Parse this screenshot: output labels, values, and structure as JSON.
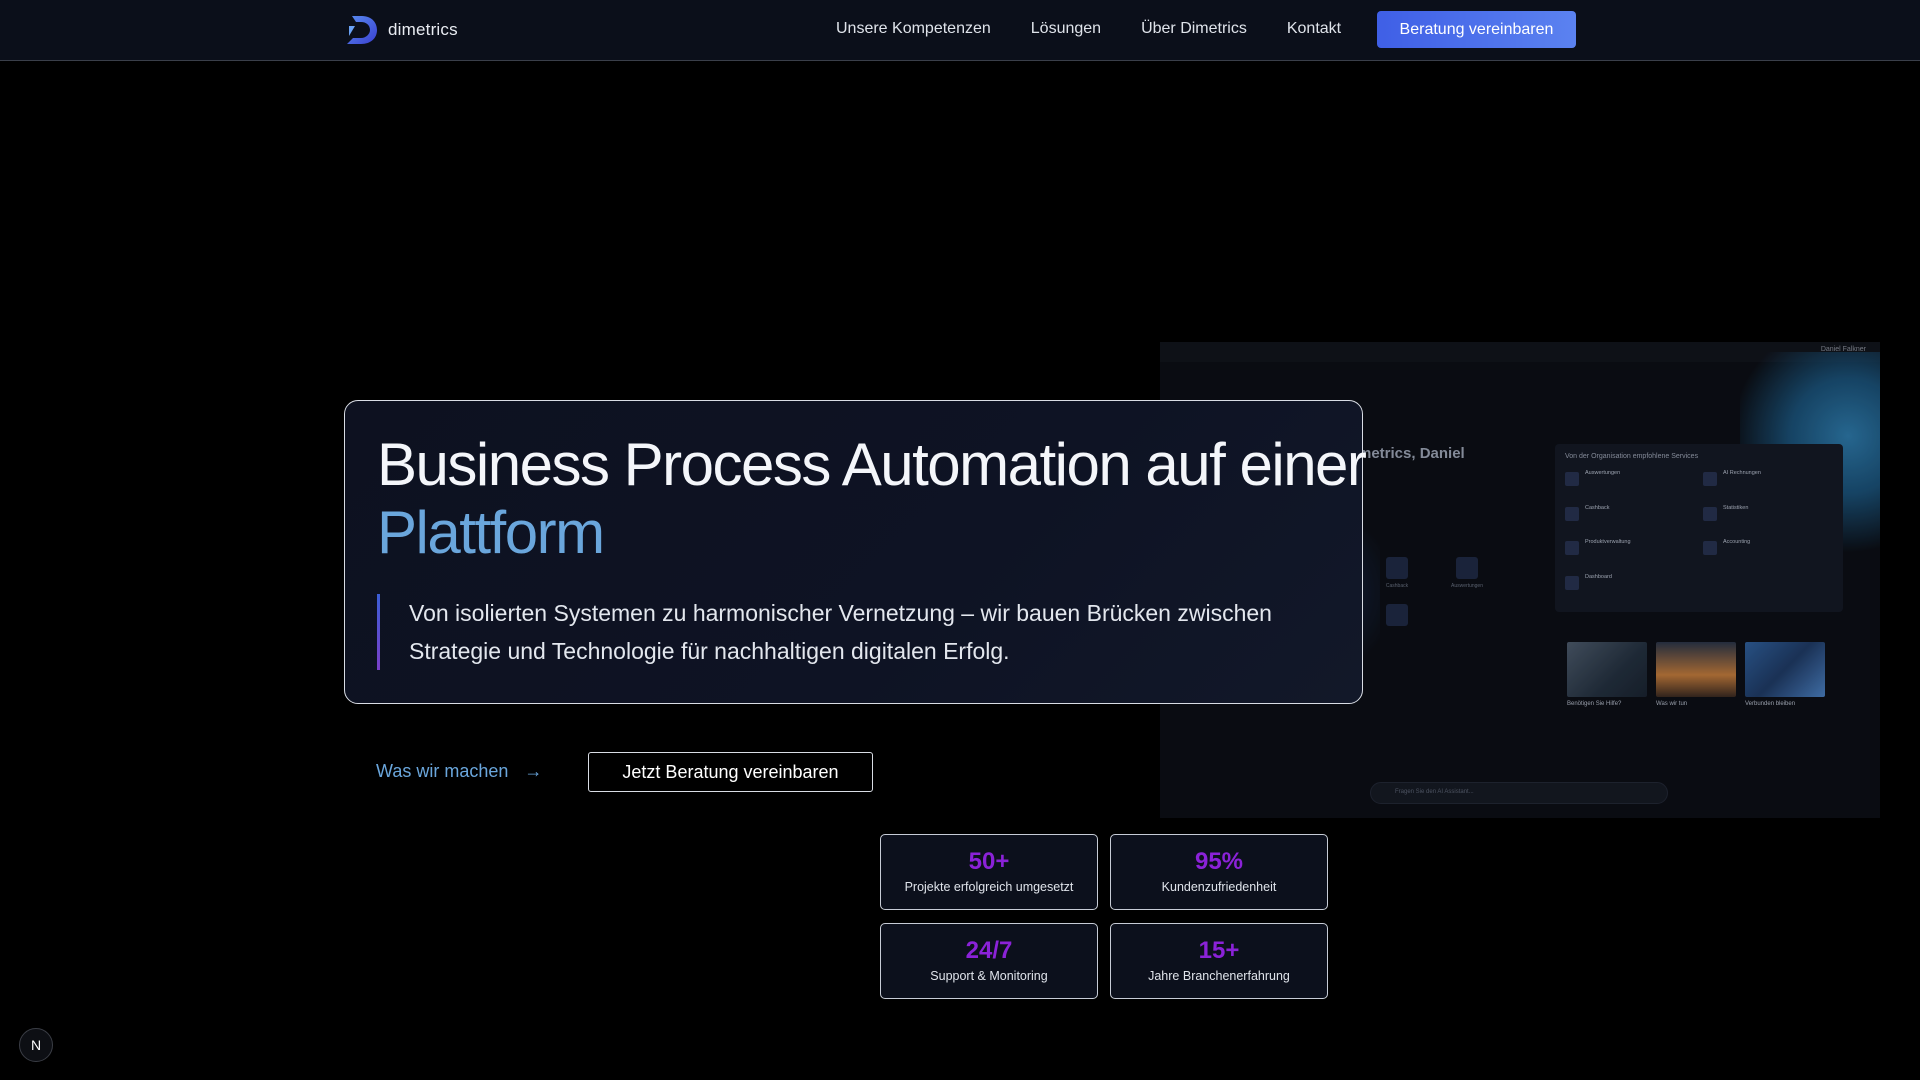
{
  "nav": {
    "logo_text": "dimetrics",
    "links": [
      "Unsere Kompetenzen",
      "Lösungen",
      "Über Dimetrics",
      "Kontakt"
    ],
    "cta": "Beratung vereinbaren"
  },
  "hero": {
    "title": "Business Process Automation auf einer",
    "title_accent": "Plattform",
    "subtitle": "Von isolierten Systemen zu harmonischer Vernetzung – wir bauen Brücken zwischen Strategie und Technologie für nachhaltigen digitalen Erfolg."
  },
  "actions": {
    "secondary": "Was wir machen",
    "secondary_icon": "arrow-right-icon",
    "primary": "Jetzt Beratung vereinbaren"
  },
  "stats": [
    {
      "value": "50+",
      "label": "Projekte erfolgreich umgesetzt"
    },
    {
      "value": "95%",
      "label": "Kundenzufriedenheit"
    },
    {
      "value": "24/7",
      "label": "Support & Monitoring"
    },
    {
      "value": "15+",
      "label": "Jahre Branchenerfahrung"
    }
  ],
  "preview": {
    "greeting": "metrics, Daniel",
    "user": "Daniel Falkner",
    "panel_title": "Von der Organisation empfohlene Services",
    "services": [
      {
        "name": "Auswertungen"
      },
      {
        "name": "AI Rechnungen"
      },
      {
        "name": "Cashback"
      },
      {
        "name": "Statistiken"
      },
      {
        "name": "Produktverwaltung"
      },
      {
        "name": "Accounting"
      },
      {
        "name": "Dashboard"
      }
    ],
    "tiles": [
      "Cashback",
      "Auswertungen"
    ],
    "cards": [
      {
        "title": "Benötigen Sie Hilfe?"
      },
      {
        "title": "Was wir tun"
      },
      {
        "title": "Verbunden bleiben"
      }
    ],
    "input_placeholder": "Fragen Sie den AI Assistant..."
  },
  "colors": {
    "accent_blue": "#6aa6dc",
    "stat_purple": "#8b22d8",
    "cta_blue": "#4a6ee8"
  },
  "badge": "N"
}
